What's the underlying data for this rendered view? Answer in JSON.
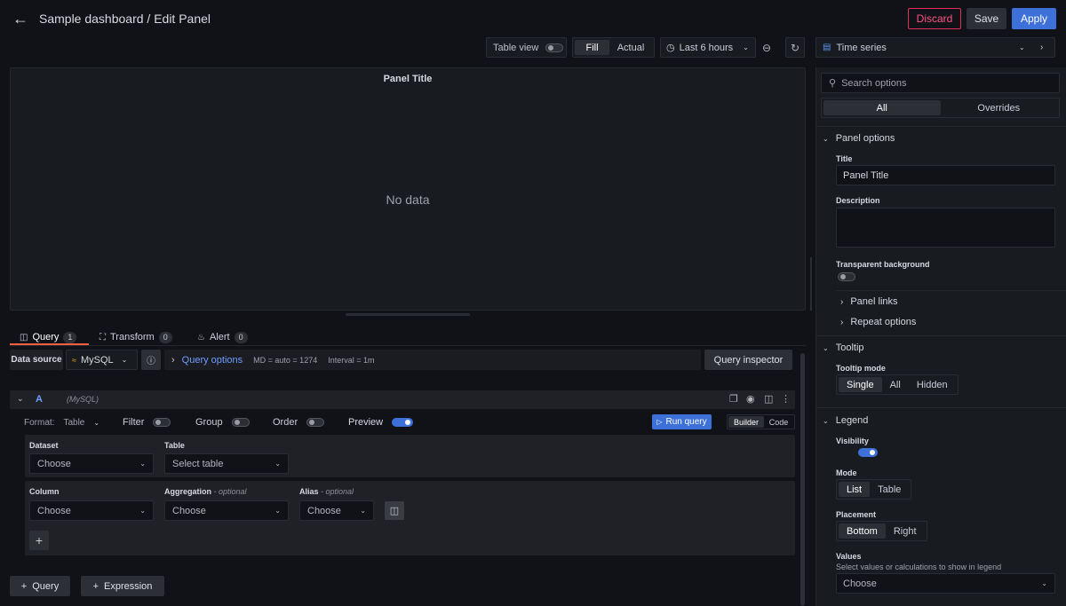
{
  "header": {
    "title": "Sample dashboard / Edit Panel",
    "discard": "Discard",
    "save": "Save",
    "apply": "Apply"
  },
  "toolbar": {
    "table_view": "Table view",
    "fill": "Fill",
    "actual": "Actual",
    "time_range": "Last 6 hours",
    "visualization": "Time series"
  },
  "panel": {
    "title": "Panel Title",
    "no_data": "No data"
  },
  "tabs": [
    {
      "label": "Query",
      "count": "1"
    },
    {
      "label": "Transform",
      "count": "0"
    },
    {
      "label": "Alert",
      "count": "0"
    }
  ],
  "query": {
    "datasource_label": "Data source",
    "datasource": "MySQL",
    "query_options": "Query options",
    "md_info": "MD = auto = 1274",
    "interval_info": "Interval = 1m",
    "inspector": "Query inspector",
    "ref_id": "A",
    "ds_name": "(MySQL)",
    "format_label": "Format:",
    "format_value": "Table",
    "filter": "Filter",
    "group": "Group",
    "order": "Order",
    "preview": "Preview",
    "run_query": "Run query",
    "builder": "Builder",
    "code": "Code",
    "dataset_label": "Dataset",
    "dataset_value": "Choose",
    "table_label": "Table",
    "table_value": "Select table",
    "column_label": "Column",
    "column_value": "Choose",
    "aggregation_label": "Aggregation",
    "aggregation_optional": "- optional",
    "aggregation_value": "Choose",
    "alias_label": "Alias",
    "alias_optional": "- optional",
    "alias_value": "Choose",
    "add_query": "Query",
    "add_expression": "Expression"
  },
  "options": {
    "search_placeholder": "Search options",
    "tab_all": "All",
    "tab_overrides": "Overrides",
    "panel_options": "Panel options",
    "title_label": "Title",
    "title_value": "Panel Title",
    "description_label": "Description",
    "transparent_label": "Transparent background",
    "panel_links": "Panel links",
    "repeat_options": "Repeat options",
    "tooltip": "Tooltip",
    "tooltip_mode": "Tooltip mode",
    "tooltip_modes": [
      "Single",
      "All",
      "Hidden"
    ],
    "legend": "Legend",
    "visibility": "Visibility",
    "mode": "Mode",
    "modes": [
      "List",
      "Table"
    ],
    "placement": "Placement",
    "placements": [
      "Bottom",
      "Right"
    ],
    "values": "Values",
    "values_desc": "Select values or calculations to show in legend",
    "values_value": "Choose"
  }
}
